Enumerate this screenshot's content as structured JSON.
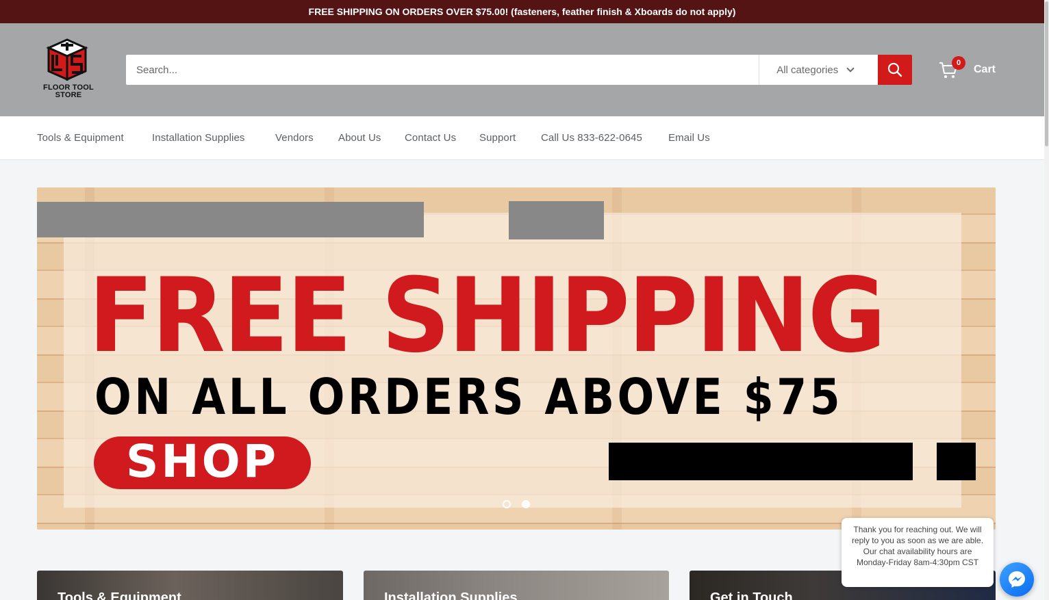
{
  "announcement": "FREE SHIPPING ON ORDERS OVER $75.00! (fasteners, feather finish & Xboards do not apply)",
  "brand": {
    "name_line1": "FLOOR TOOL",
    "name_line2": "STORE",
    "accent": "#d21a1a"
  },
  "search": {
    "placeholder": "Search...",
    "category": "All categories"
  },
  "cart": {
    "count": "0",
    "label": "Cart"
  },
  "nav": [
    "Tools & Equipment",
    "Installation Supplies",
    "Vendors",
    "About Us",
    "Contact Us",
    "Support",
    "Call Us 833-622-0645",
    "Email Us"
  ],
  "banner": {
    "headline": "FREE SHIPPING",
    "subline": "ON ALL ORDERS ABOVE $75",
    "button": "SHOP",
    "slides": 2,
    "active_slide": 2
  },
  "cards": [
    {
      "title": "Tools & Equipment"
    },
    {
      "title": "Installation Supplies"
    },
    {
      "title": "Get in Touch"
    }
  ],
  "chat": {
    "line1": "Thank you for reaching out. We will reply to you as soon as we are able.",
    "line2": "Our chat availability hours are Monday-Friday 8am-4:30pm CST"
  },
  "icons": [
    "search-icon",
    "cart-icon",
    "chevron-down-icon",
    "messenger-icon"
  ]
}
